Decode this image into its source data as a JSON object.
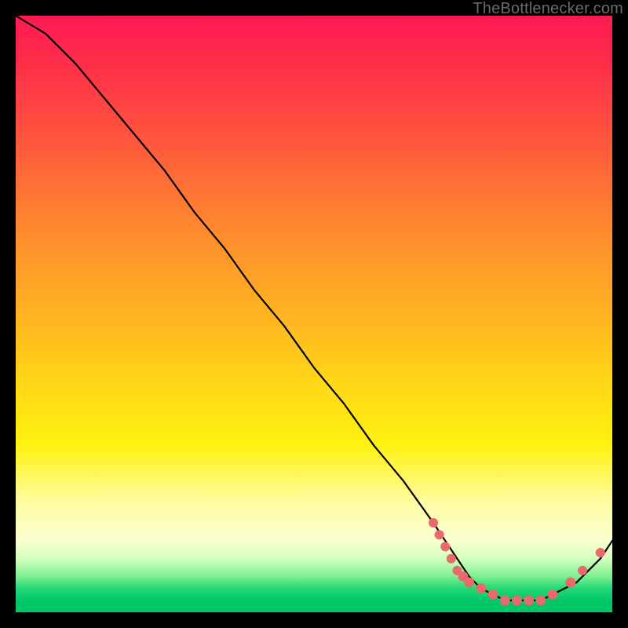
{
  "credit": "TheBottlenecker.com",
  "chart_data": {
    "type": "line",
    "title": "",
    "xlabel": "",
    "ylabel": "",
    "xlim": [
      0,
      100
    ],
    "ylim": [
      0,
      100
    ],
    "series": [
      {
        "name": "bottleneck-curve",
        "x": [
          0,
          5,
          10,
          15,
          20,
          25,
          30,
          35,
          40,
          45,
          50,
          55,
          60,
          65,
          70,
          72,
          74,
          76,
          78,
          80,
          82,
          84,
          86,
          88,
          90,
          92,
          94,
          96,
          98,
          100
        ],
        "y": [
          100,
          97,
          92,
          86,
          80,
          74,
          67,
          61,
          54,
          48,
          41,
          35,
          28,
          22,
          15,
          12,
          9,
          6,
          4,
          3,
          2,
          2,
          2,
          2,
          3,
          4,
          5,
          7,
          9,
          12
        ]
      }
    ],
    "highlight_dots": {
      "name": "selected-points",
      "points": [
        {
          "x": 70,
          "y": 15
        },
        {
          "x": 71,
          "y": 13
        },
        {
          "x": 72,
          "y": 11
        },
        {
          "x": 73,
          "y": 9
        },
        {
          "x": 74,
          "y": 7
        },
        {
          "x": 75,
          "y": 6
        },
        {
          "x": 76,
          "y": 5
        },
        {
          "x": 78,
          "y": 4
        },
        {
          "x": 80,
          "y": 3
        },
        {
          "x": 82,
          "y": 2
        },
        {
          "x": 84,
          "y": 2
        },
        {
          "x": 86,
          "y": 2
        },
        {
          "x": 88,
          "y": 2
        },
        {
          "x": 90,
          "y": 3
        },
        {
          "x": 93,
          "y": 5
        },
        {
          "x": 95,
          "y": 7
        },
        {
          "x": 98,
          "y": 10
        }
      ]
    }
  }
}
